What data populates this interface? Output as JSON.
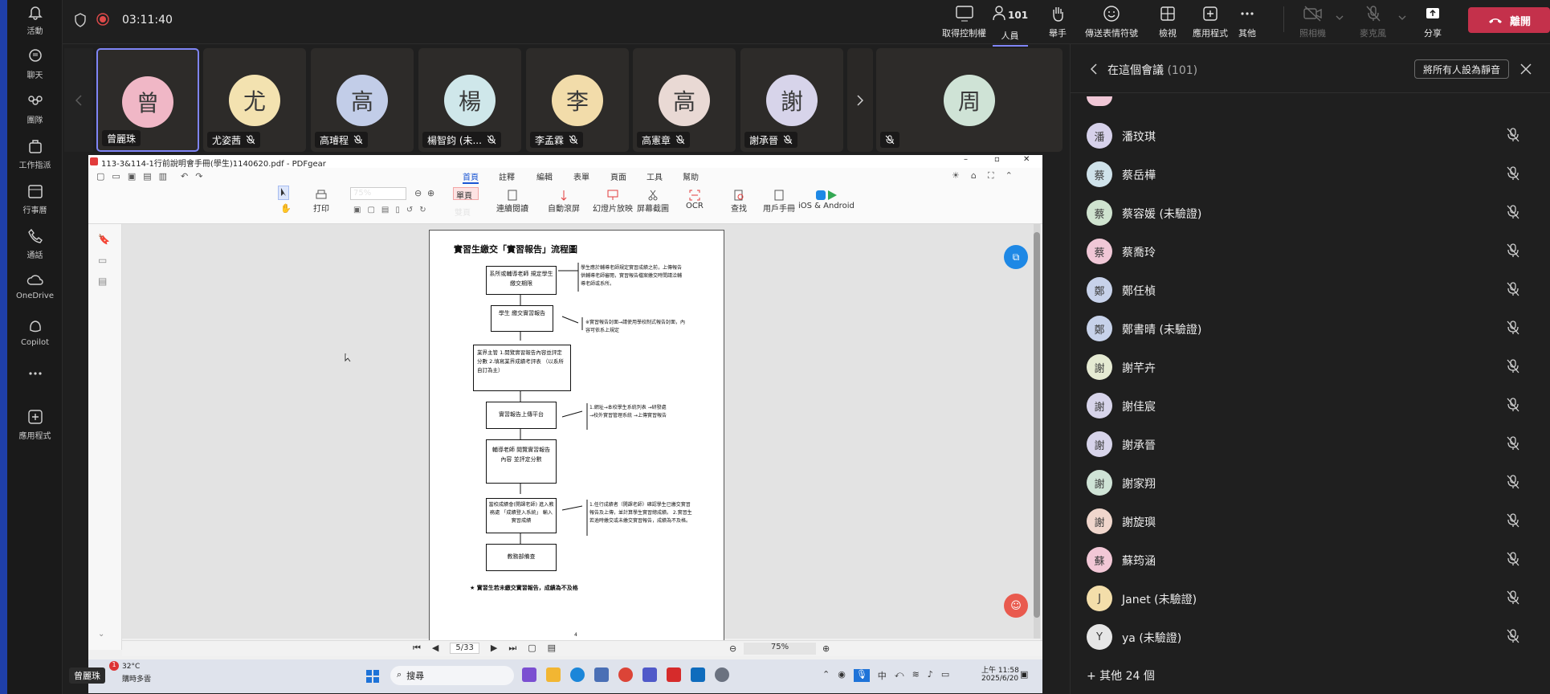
{
  "rail": {
    "items": [
      {
        "label": "活動",
        "icon": "bell-icon"
      },
      {
        "label": "聊天",
        "icon": "chat-icon"
      },
      {
        "label": "團隊",
        "icon": "teams-icon"
      },
      {
        "label": "工作指派",
        "icon": "bag-icon"
      },
      {
        "label": "行事曆",
        "icon": "calendar-icon"
      },
      {
        "label": "通話",
        "icon": "phone-icon"
      },
      {
        "label": "OneDrive",
        "icon": "cloud-icon"
      },
      {
        "label": "Copilot",
        "icon": "copilot-icon"
      },
      {
        "label": "",
        "icon": "more-icon"
      },
      {
        "label": "應用程式",
        "icon": "add-app-icon"
      }
    ]
  },
  "meeting": {
    "timer": "03:11:40",
    "toolbar": {
      "control": "取得控制權",
      "people": "人員",
      "people_count": "101",
      "raise_hand": "舉手",
      "react": "傳送表情符號",
      "view": "檢視",
      "apps": "應用程式",
      "more": "其他",
      "camera": "照相機",
      "mic": "麥克風",
      "share": "分享",
      "leave": "離開"
    }
  },
  "participants_strip": [
    {
      "initial": "曾",
      "name": "曾麗珠",
      "color": "#f0b7c6",
      "muted": false,
      "active": true
    },
    {
      "initial": "尤",
      "name": "尤姿茜",
      "color": "#f3e2b0",
      "muted": true
    },
    {
      "initial": "高",
      "name": "高璿程",
      "color": "#c2cde8",
      "muted": true
    },
    {
      "initial": "楊",
      "name": "楊智鈞 (未...",
      "color": "#cfe7ea",
      "muted": true
    },
    {
      "initial": "李",
      "name": "李孟霖",
      "color": "#f2dcaa",
      "muted": true
    },
    {
      "initial": "高",
      "name": "高憲章",
      "color": "#e9d9d4",
      "muted": true
    },
    {
      "initial": "謝",
      "name": "謝承晉",
      "color": "#d7d4ea",
      "muted": true
    },
    {
      "initial": "周",
      "name": "",
      "color": "#cfe3d6",
      "muted": true
    }
  ],
  "pdf": {
    "window_title": "113-3&114-1行前說明會手冊(學生)1140620.pdf - PDFgear",
    "tabs": [
      "首頁",
      "註釋",
      "編輯",
      "表單",
      "頁面",
      "工具",
      "幫助"
    ],
    "zoom": "75%",
    "ribbon": {
      "print": "打印",
      "single_page": "單頁",
      "double_page": "雙頁",
      "continuous": "連續閱讀",
      "auto_scroll": "自動滾屏",
      "slideshow": "幻燈片放映",
      "screenshot": "屏幕截圖",
      "ocr": "OCR",
      "find": "查找",
      "manual": "用戶手冊",
      "mobile": "iOS & Android"
    },
    "page_indicator": "5/33",
    "bottom_zoom": "75%",
    "doc": {
      "title": "實習生繳交「實習報告」流程圖",
      "boxes": [
        "系所或輔導老師 規定學生繳交期限",
        "學生 繳交實習報告",
        "業界主管 1.閱覽實習報告內容並評定分數 2.填寫業界成績考評表 （以系所自訂為主）",
        "實習報告上傳平台",
        "輔導老師 閱覽實習報告內容 並評定分數",
        "當校成績會(開課老師) 進入教務處 「成績登入系統」 輸入實習成績",
        "教務部備查"
      ],
      "notes": [
        "學生應於輔導老師規定實習成績之前，上傳報告供輔導老師審閱，實習報告檔案繳交時間請洽輔導老師或系所。",
        "※實習報告封面→請使用學校制式報告封面，內容可依系上規定",
        "1.網址→本校學生系統列表 →研發處→校外實習管理系統 →上傳實習報告",
        "1.任行成績者（開課老師）確認學生已繳交實習報告及上傳，並計算學生實習總成績。 2.實習生若逾時繳交或未繳交實習報告，成績為不及格。"
      ],
      "footer": "★ 實習生若未繳交實習報告，成績為不及格",
      "page_num": "4"
    }
  },
  "taskbar": {
    "presenter_badge": "曾麗珠",
    "weather_temp": "32°C",
    "weather_desc": "購時多雲",
    "search": "搜尋",
    "ime": "中",
    "time": "上午 11:58",
    "date": "2025/6/20"
  },
  "panel": {
    "title": "在這個會議",
    "count": "(101)",
    "mute_all": "將所有人設為靜音",
    "people": [
      {
        "initial": "潘",
        "name": "潘玟琪",
        "color": "#d6d1ea"
      },
      {
        "initial": "蔡",
        "name": "蔡岳樺",
        "color": "#cfe2ea"
      },
      {
        "initial": "蔡",
        "name": "蔡容媛 (未驗證)",
        "color": "#cfe3cf"
      },
      {
        "initial": "蔡",
        "name": "蔡喬玲",
        "color": "#f0c7d6"
      },
      {
        "initial": "鄭",
        "name": "鄭任楨",
        "color": "#c7d2ea"
      },
      {
        "initial": "鄭",
        "name": "鄭書晴 (未驗證)",
        "color": "#c7d2ea"
      },
      {
        "initial": "謝",
        "name": "謝芊卉",
        "color": "#e5ead2"
      },
      {
        "initial": "謝",
        "name": "謝佳宸",
        "color": "#d7d4ea"
      },
      {
        "initial": "謝",
        "name": "謝承晉",
        "color": "#d7d4ea"
      },
      {
        "initial": "謝",
        "name": "謝家翔",
        "color": "#cfe3d6"
      },
      {
        "initial": "謝",
        "name": "謝旋璵",
        "color": "#f0d6cc"
      },
      {
        "initial": "蘇",
        "name": "蘇筠涵",
        "color": "#f2c7d6"
      },
      {
        "initial": "J",
        "name": "Janet (未驗證)",
        "color": "#f3deaa"
      },
      {
        "initial": "Y",
        "name": "ya (未驗證)",
        "color": "#e6e6e6"
      }
    ],
    "more": "+ 其他 24 個"
  }
}
